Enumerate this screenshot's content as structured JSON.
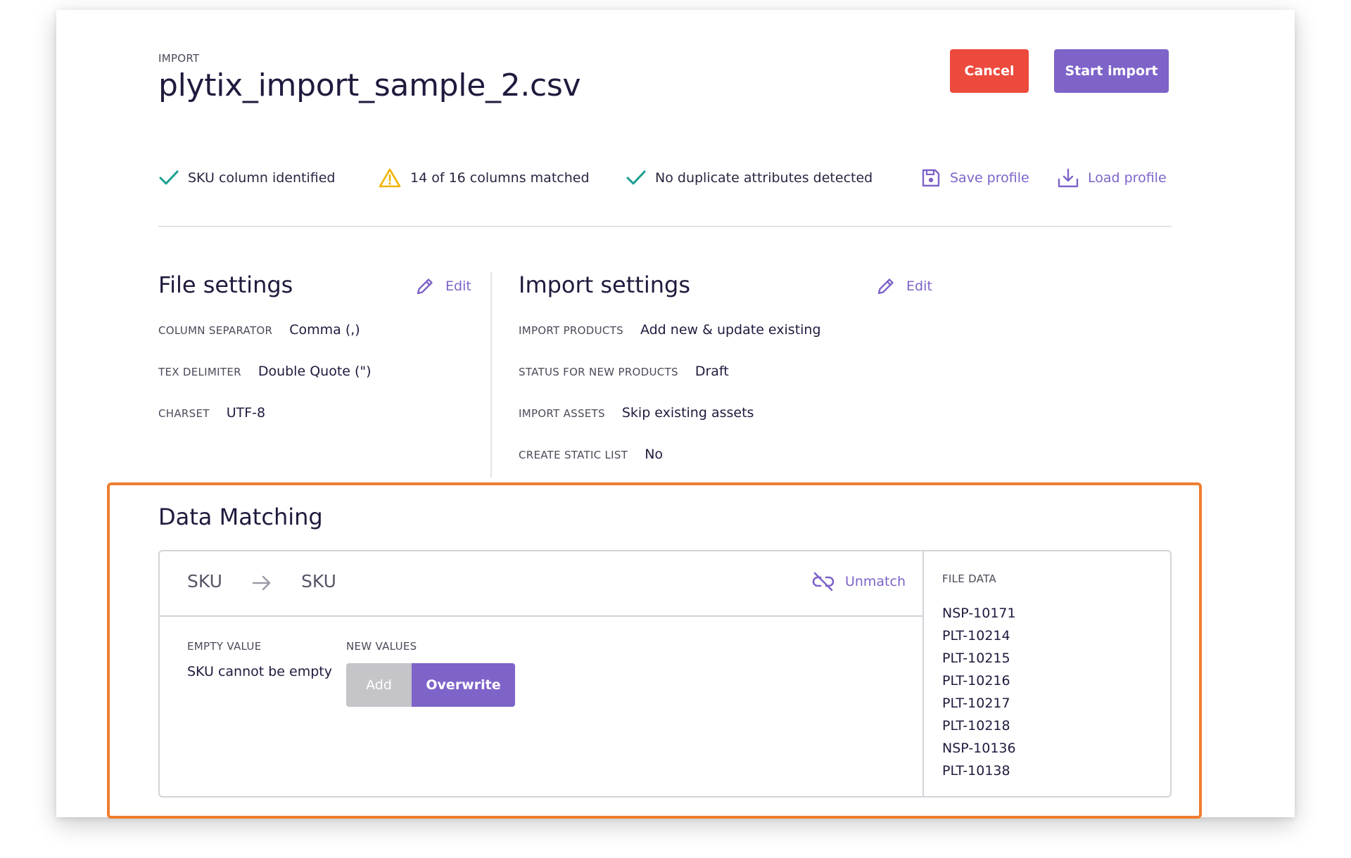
{
  "header": {
    "eyebrow": "IMPORT",
    "title": "plytix_import_sample_2.csv",
    "cancel_label": "Cancel",
    "start_label": "Start import"
  },
  "status": {
    "sku": "SKU column identified",
    "columns": "14 of 16 columns matched",
    "duplicates": "No duplicate attributes detected",
    "save_profile": "Save profile",
    "load_profile": "Load profile"
  },
  "file_settings": {
    "title": "File settings",
    "edit_label": "Edit",
    "rows": [
      {
        "key": "COLUMN SEPARATOR",
        "value": "Comma (,)"
      },
      {
        "key": "TEX DELIMITER",
        "value": "Double Quote (\")"
      },
      {
        "key": "CHARSET",
        "value": "UTF-8"
      }
    ]
  },
  "import_settings": {
    "title": "Import settings",
    "edit_label": "Edit",
    "rows": [
      {
        "key": "IMPORT PRODUCTS",
        "value": "Add new & update existing"
      },
      {
        "key": "STATUS FOR NEW PRODUCTS",
        "value": "Draft"
      },
      {
        "key": "IMPORT ASSETS",
        "value": "Skip existing assets"
      },
      {
        "key": "CREATE STATIC LIST",
        "value": "No"
      }
    ]
  },
  "data_matching": {
    "title": "Data Matching",
    "source_column": "SKU",
    "target_attribute": "SKU",
    "unmatch_label": "Unmatch",
    "empty_value_label": "EMPTY VALUE",
    "empty_value_text": "SKU cannot be empty",
    "new_values_label": "NEW VALUES",
    "options": [
      "Add",
      "Overwrite"
    ],
    "selected_option": "Overwrite",
    "file_data_label": "FILE DATA",
    "file_data": [
      "NSP-10171",
      "PLT-10214",
      "PLT-10215",
      "PLT-10216",
      "PLT-10217",
      "PLT-10218",
      "NSP-10136",
      "PLT-10138"
    ]
  },
  "colors": {
    "accent": "#7e63c9",
    "cancel": "#ec4a3c",
    "success": "#1a9e8f",
    "warning": "#f0b400",
    "highlight": "#ef7d2f"
  }
}
